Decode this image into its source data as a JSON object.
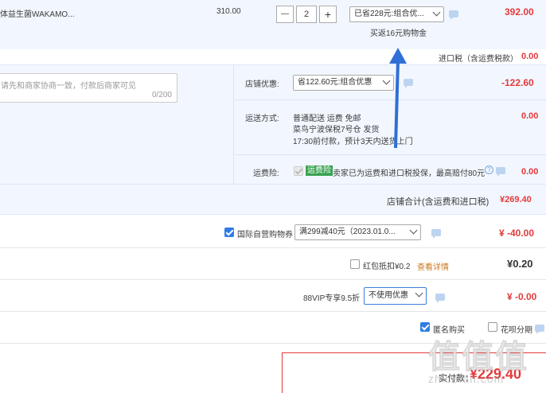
{
  "product": {
    "name": "体益生菌WAKAMO...",
    "unit_price": "310.00",
    "qty": "2",
    "minus": "—",
    "plus": "+",
    "discount_select": "已省228元:组合优...",
    "discount_note": "买返16元购物金",
    "total": "392.00"
  },
  "import_tax": {
    "label": "进口税（含运费税款）",
    "value": "0.00"
  },
  "message": {
    "placeholder": "请先和商家协商一致，付款后商家可见",
    "counter": "0/200"
  },
  "shop_discount": {
    "label": "店铺优惠:",
    "select": "省122.60元:组合优惠",
    "value": "-122.60"
  },
  "shipping": {
    "label": "运送方式:",
    "line1": "普通配送 运费 免邮",
    "line2": "菜鸟宁波保税7号仓  发货",
    "line3": "17:30前付款，预计3天内送货上门",
    "value": "0.00"
  },
  "insurance": {
    "label": "运费险:",
    "badge": "运费险",
    "text": "卖家已为运费和进口税投保，最高赔付80元",
    "value": "0.00"
  },
  "shop_total": {
    "label": "店铺合计(含运费和进口税)",
    "value": "¥269.40"
  },
  "coupon": {
    "label": "国际自营购物券",
    "select": "满299减40元（2023.01.0...",
    "value": "¥ -40.00"
  },
  "redpacket": {
    "label": "红包抵扣¥0.2",
    "link": "查看详情",
    "value": "¥0.20"
  },
  "vip": {
    "label": "88VIP专享9.5折",
    "select": "不使用优惠",
    "value": "¥ -0.00"
  },
  "options": {
    "anon": "匿名购买",
    "huabei": "花呗分期"
  },
  "pay": {
    "label": "实付款：",
    "value": "¥229.40"
  },
  "watermark": {
    "text": "值值值",
    "url": "zhidefan.com"
  },
  "colors": {
    "accent": "#e4393c",
    "blue": "#2e7ce6",
    "section_bg": "#f2f7ff",
    "arrow": "#2f6fd6"
  }
}
